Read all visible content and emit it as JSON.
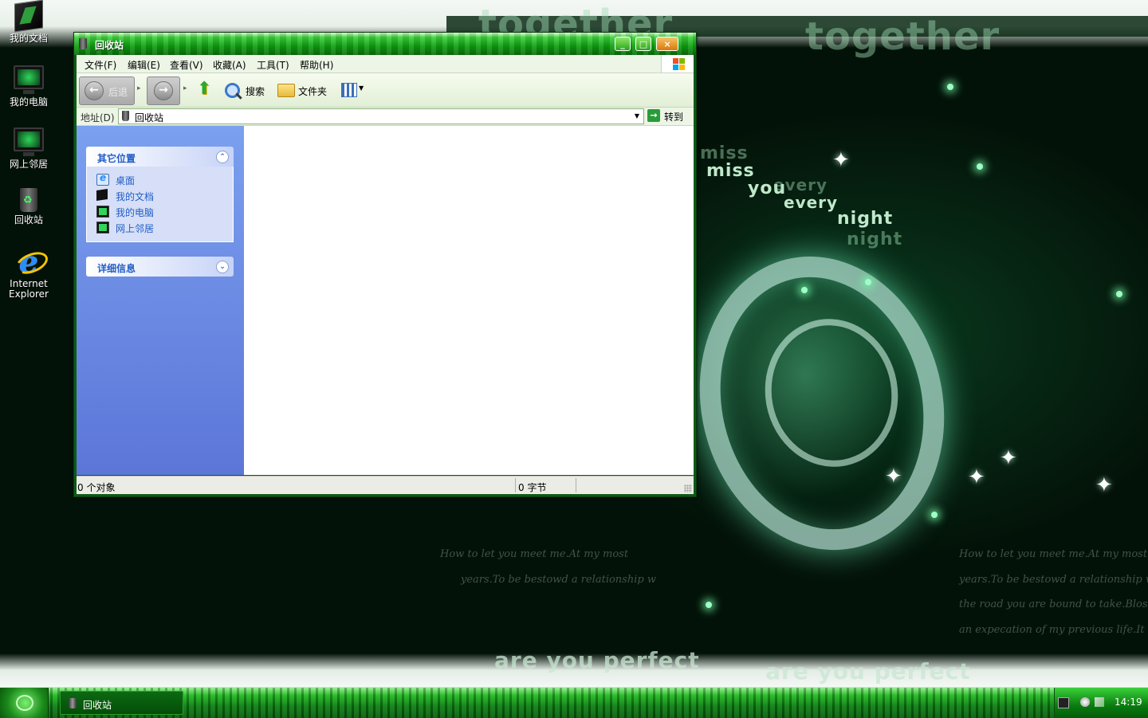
{
  "desktop": {
    "icons": [
      {
        "label": "我的文档",
        "icon": "my-documents-icon"
      },
      {
        "label": "我的电脑",
        "icon": "my-computer-icon"
      },
      {
        "label": "网上邻居",
        "icon": "network-places-icon"
      },
      {
        "label": "回收站",
        "icon": "recycle-bin-icon"
      },
      {
        "label": "Internet Explorer",
        "icon": "internet-explorer-icon"
      }
    ],
    "wallpaper_text": {
      "w1": "miss",
      "w2": "you",
      "w3": "every",
      "w4": "night",
      "banner1": "are you perfect",
      "banner2": "together",
      "hand1": "How to let you meet me.At my most",
      "hand2": "years.To be bestowd a relationship w",
      "hand3": "the road you are bound to take.Bloss",
      "hand4": "an expecation of my previous life.It"
    }
  },
  "window": {
    "title": "回收站",
    "controls": {
      "minimize": "_",
      "maximize": "□",
      "close": "×"
    },
    "menu": [
      "文件(F)",
      "编辑(E)",
      "查看(V)",
      "收藏(A)",
      "工具(T)",
      "帮助(H)"
    ],
    "toolbar": {
      "back": "后退",
      "search": "搜索",
      "folders": "文件夹"
    },
    "address": {
      "label": "地址(D)",
      "value": "回收站",
      "go": "转到"
    },
    "left_pane": {
      "other_places": {
        "title": "其它位置",
        "items": [
          "桌面",
          "我的文档",
          "我的电脑",
          "网上邻居"
        ]
      },
      "details": {
        "title": "详细信息"
      }
    },
    "status": {
      "objects": "0 个对象",
      "size": "0 字节"
    }
  },
  "taskbar": {
    "task": "回收站",
    "clock": "14:19"
  },
  "colors": {
    "titlebar": "#10a012",
    "task_pane": "#7ba0ef",
    "taskbar": "#0a7d10",
    "link": "#215dc6"
  }
}
